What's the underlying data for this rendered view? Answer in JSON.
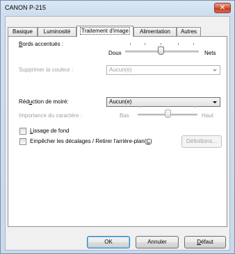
{
  "window": {
    "title": "CANON  P-215",
    "close_label": "✕"
  },
  "tabs": [
    {
      "label": "Basique"
    },
    {
      "label": "Luminosité"
    },
    {
      "label": "Traitement d'image"
    },
    {
      "label": "Alimentation"
    },
    {
      "label": "Autres"
    }
  ],
  "active_tab": "Traitement d'image",
  "edges": {
    "label_prefix": "B",
    "label_rest": "ords accentués :",
    "left_label": "Doux",
    "right_label": "Nets",
    "level": 0.5
  },
  "remove_color": {
    "label": "Supprimer la couleur :",
    "value": "Aucun(e)",
    "enabled": false
  },
  "moire": {
    "label_pre": "Réd",
    "label_u": "u",
    "label_post": "ction de moiré:",
    "value": "Aucun(e)"
  },
  "char_importance": {
    "label": "Importance du caractère :",
    "left_label": "Bas",
    "right_label": "Haut",
    "level": 0.5,
    "enabled": false
  },
  "background_smoothing": {
    "label_u": "L",
    "label_rest": "issage de fond",
    "checked": false
  },
  "prevent_bleed": {
    "label": "Empêcher les décalages / Retirer l'arrière-plan(",
    "label_u": "C",
    "label_end": ")",
    "checked": false,
    "definitions_button": "Définitions..."
  },
  "footer": {
    "ok": "OK",
    "cancel": "Annuler",
    "default_u": "D",
    "default_rest": "éfaut"
  },
  "colors": {
    "accent": "#3c7fb1",
    "close": "#c2391c",
    "disabled_text": "#a0a0a0"
  }
}
